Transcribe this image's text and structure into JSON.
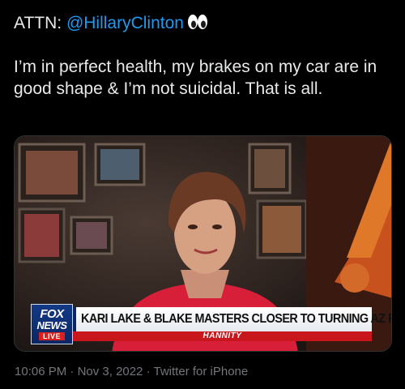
{
  "tweet": {
    "prefix": "ATTN: ",
    "mention": "@HillaryClinton",
    "emoji": "eyes-emoji",
    "body": "I’m in perfect health, my brakes on my car are in good shape & I’m not suicidal. That is all."
  },
  "media": {
    "logo_line1": "FOX",
    "logo_line2": "NEWS",
    "live_label": "LIVE",
    "headline": "KARI LAKE & BLAKE MASTERS CLOSER TO TURNING AZ RED",
    "show_name": "HANNITY"
  },
  "meta": {
    "time": "10:06 PM",
    "sep1": " · ",
    "date": "Nov 3, 2022",
    "sep2": " · ",
    "source": "Twitter for iPhone"
  },
  "colors": {
    "background": "#000000",
    "text": "#e7e9ea",
    "mention": "#1d9bf0",
    "meta": "#71767b",
    "fox_blue": "#0b2664",
    "fox_red": "#c8161d"
  }
}
